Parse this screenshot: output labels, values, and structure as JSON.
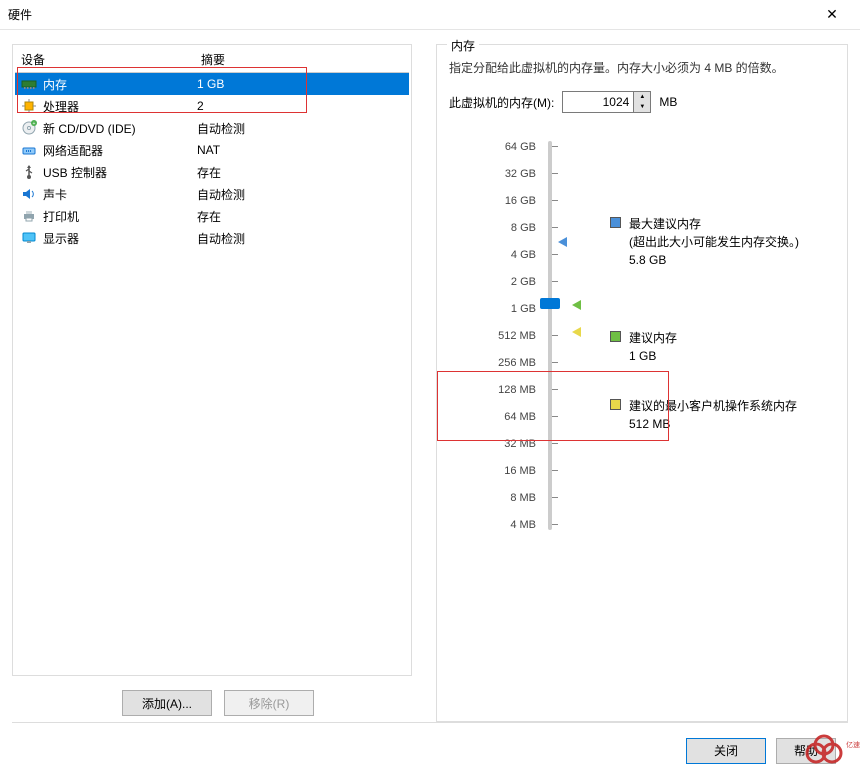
{
  "titlebar": {
    "title": "硬件"
  },
  "columns": {
    "device": "设备",
    "summary": "摘要"
  },
  "devices": [
    {
      "name": "内存",
      "summary": "1 GB",
      "icon": "memory-icon",
      "selected": true
    },
    {
      "name": "处理器",
      "summary": "2",
      "icon": "cpu-icon",
      "selected": false
    },
    {
      "name": "新 CD/DVD (IDE)",
      "summary": "自动检测",
      "icon": "cd-icon",
      "selected": false
    },
    {
      "name": "网络适配器",
      "summary": "NAT",
      "icon": "network-icon",
      "selected": false
    },
    {
      "name": "USB 控制器",
      "summary": "存在",
      "icon": "usb-icon",
      "selected": false
    },
    {
      "name": "声卡",
      "summary": "自动检测",
      "icon": "sound-icon",
      "selected": false
    },
    {
      "name": "打印机",
      "summary": "存在",
      "icon": "printer-icon",
      "selected": false
    },
    {
      "name": "显示器",
      "summary": "自动检测",
      "icon": "monitor-icon",
      "selected": false
    }
  ],
  "buttons": {
    "add": "添加(A)...",
    "remove": "移除(R)",
    "close": "关闭",
    "help": "帮助"
  },
  "memory": {
    "group_title": "内存",
    "desc": "指定分配给此虚拟机的内存量。内存大小必须为 4 MB 的倍数。",
    "label": "此虚拟机的内存(M):",
    "value": "1024",
    "unit": "MB",
    "ticks": [
      "64 GB",
      "32 GB",
      "16 GB",
      "8 GB",
      "4 GB",
      "2 GB",
      "1 GB",
      "512 MB",
      "256 MB",
      "128 MB",
      "64 MB",
      "32 MB",
      "16 MB",
      "8 MB",
      "4 MB"
    ],
    "legend": {
      "max": {
        "title": "最大建议内存",
        "note": "(超出此大小可能发生内存交换。)",
        "value": "5.8 GB"
      },
      "rec": {
        "title": "建议内存",
        "value": "1 GB"
      },
      "min": {
        "title": "建议的最小客户机操作系统内存",
        "value": "512 MB"
      }
    }
  }
}
